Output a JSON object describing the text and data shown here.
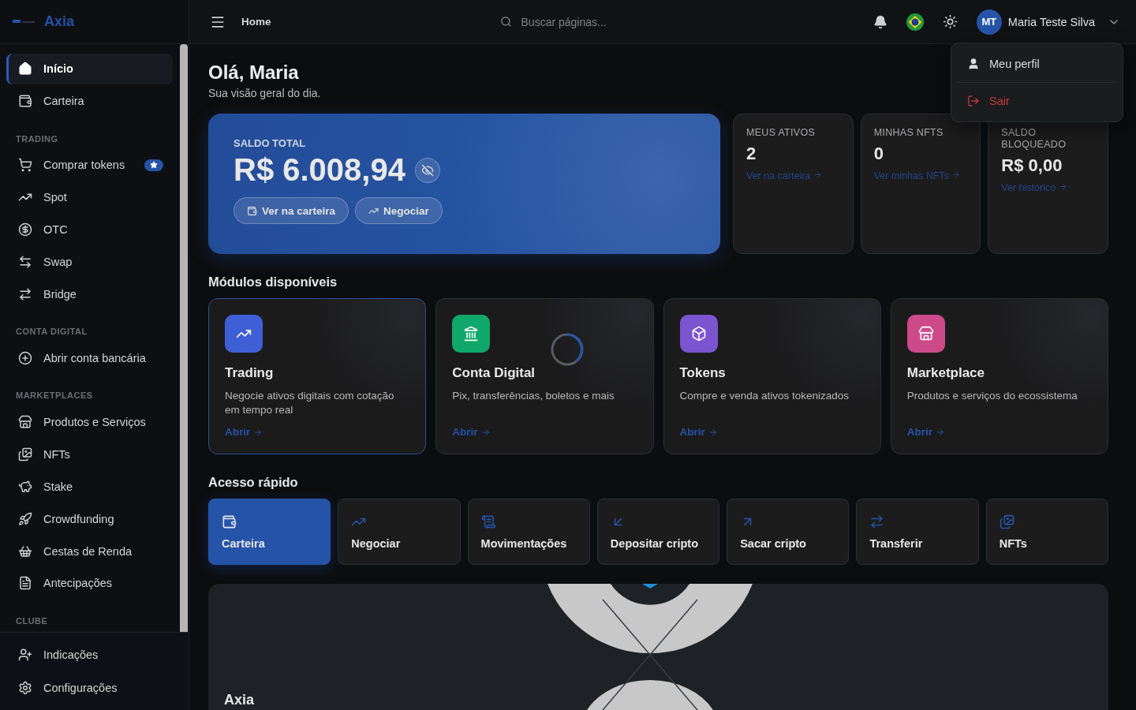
{
  "sidebar": {
    "logo": "Axia",
    "sections": [
      {
        "items": [
          {
            "label": "Início",
            "selected": true,
            "badge": false
          },
          {
            "label": "Carteira",
            "selected": false,
            "badge": false
          }
        ]
      },
      {
        "heading": "TRADING",
        "items": [
          {
            "label": "Comprar tokens",
            "selected": false,
            "badge": true
          },
          {
            "label": "Spot",
            "selected": false,
            "badge": false
          },
          {
            "label": "OTC",
            "selected": false,
            "badge": false
          },
          {
            "label": "Swap",
            "selected": false,
            "badge": false
          },
          {
            "label": "Bridge",
            "selected": false,
            "badge": false
          }
        ]
      },
      {
        "heading": "CONTA DIGITAL",
        "items": [
          {
            "label": "Abrir conta bancária",
            "selected": false,
            "badge": false
          }
        ]
      },
      {
        "heading": "MARKETPLACES",
        "items": [
          {
            "label": "Produtos e Serviços",
            "selected": false,
            "badge": false
          },
          {
            "label": "NFTs",
            "selected": false,
            "badge": false
          },
          {
            "label": "Stake",
            "selected": false,
            "badge": false
          },
          {
            "label": "Crowdfunding",
            "selected": false,
            "badge": false
          },
          {
            "label": "Cestas de Renda",
            "selected": false,
            "badge": false
          },
          {
            "label": "Antecipações",
            "selected": false,
            "badge": false
          }
        ]
      },
      {
        "heading": "CLUBE"
      }
    ],
    "footer_items": [
      {
        "label": "Indicações",
        "selected": false
      },
      {
        "label": "Configurações",
        "selected": false
      }
    ]
  },
  "topbar": {
    "breadcrumb": "Home",
    "search": {
      "placeholder": "Buscar páginas..."
    },
    "user": {
      "initials": "MT",
      "name": "Maria Teste Silva"
    }
  },
  "user_menu": [
    {
      "label": "Meu perfil",
      "kind": "normal"
    },
    {
      "label": "Sair",
      "kind": "danger"
    }
  ],
  "greeting": {
    "title": "Olá, Maria",
    "subtitle": "Sua visão geral do dia."
  },
  "balance": {
    "label": "SALDO TOTAL",
    "amount": "R$ 6.008,94",
    "buttons": [
      "Ver na carteira",
      "Negociar"
    ]
  },
  "stats": [
    {
      "label": "MEUS ATIVOS",
      "value": "2",
      "link": "Ver na carteira"
    },
    {
      "label": "MINHAS NFTS",
      "value": "0",
      "link": "Ver minhas NFTs"
    },
    {
      "label": "SALDO BLOQUEADO",
      "value": "R$ 0,00",
      "link": "Ver histórico"
    }
  ],
  "modules": {
    "heading": "Módulos disponíveis",
    "items": [
      {
        "title": "Trading",
        "description": "Negocie ativos digitais com cotação em tempo real",
        "link": "Abrir",
        "selected": true,
        "loading": false,
        "color": "#3f5fd6"
      },
      {
        "title": "Conta Digital",
        "description": "Pix, transferências, boletos e mais",
        "link": "Abrir",
        "selected": false,
        "loading": true,
        "color": "#10a86a"
      },
      {
        "title": "Tokens",
        "description": "Compre e venda ativos tokenizados",
        "link": "Abrir",
        "selected": false,
        "loading": false,
        "color": "#7b55d0"
      },
      {
        "title": "Marketplace",
        "description": "Produtos e serviços do ecossistema",
        "link": "Abrir",
        "selected": false,
        "loading": false,
        "color": "#cc4a8a"
      }
    ]
  },
  "quick_access": {
    "heading": "Acesso rápido",
    "items": [
      {
        "label": "Carteira",
        "selected": true
      },
      {
        "label": "Negociar",
        "selected": false
      },
      {
        "label": "Movimentações",
        "selected": false
      },
      {
        "label": "Depositar cripto",
        "selected": false
      },
      {
        "label": "Sacar cripto",
        "selected": false
      },
      {
        "label": "Transferir",
        "selected": false
      },
      {
        "label": "NFTs",
        "selected": false
      }
    ]
  },
  "banner": {
    "title": "Axia"
  }
}
